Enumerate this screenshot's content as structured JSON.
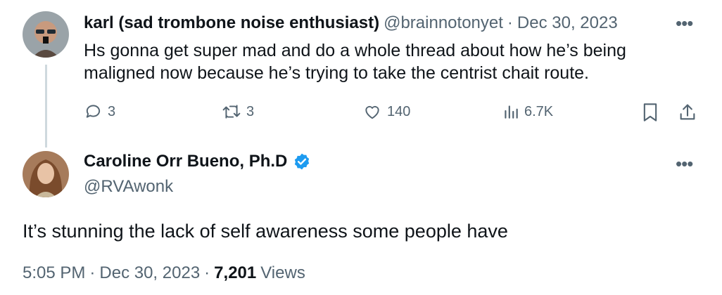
{
  "reply_tweet": {
    "author_name": "karl (sad trombone noise enthusiast)",
    "handle": "@brainnotonyet",
    "separator": "·",
    "date": "Dec 30, 2023",
    "text_line1": "Hs gonna get super mad and do a whole thread about how he’s being",
    "text_line2": "maligned now because he’s trying to take the centrist chait route.",
    "replies": "3",
    "retweets": "3",
    "likes": "140",
    "views": "6.7K"
  },
  "main_tweet": {
    "author_name": "Caroline Orr Bueno, Ph.D",
    "handle": "@RVAwonk",
    "text": "It’s stunning the lack of self awareness some people have",
    "time": "5:05 PM",
    "separator": "·",
    "date": "Dec 30, 2023",
    "view_count": "7,201",
    "views_label": "Views"
  },
  "colors": {
    "verified": "#1d9bf0",
    "muted": "#536471",
    "thread_line": "#cfd9de"
  },
  "icons": [
    "reply-icon",
    "retweet-icon",
    "like-icon",
    "views-icon",
    "bookmark-icon",
    "share-icon",
    "more-icon",
    "verified-badge-icon"
  ]
}
